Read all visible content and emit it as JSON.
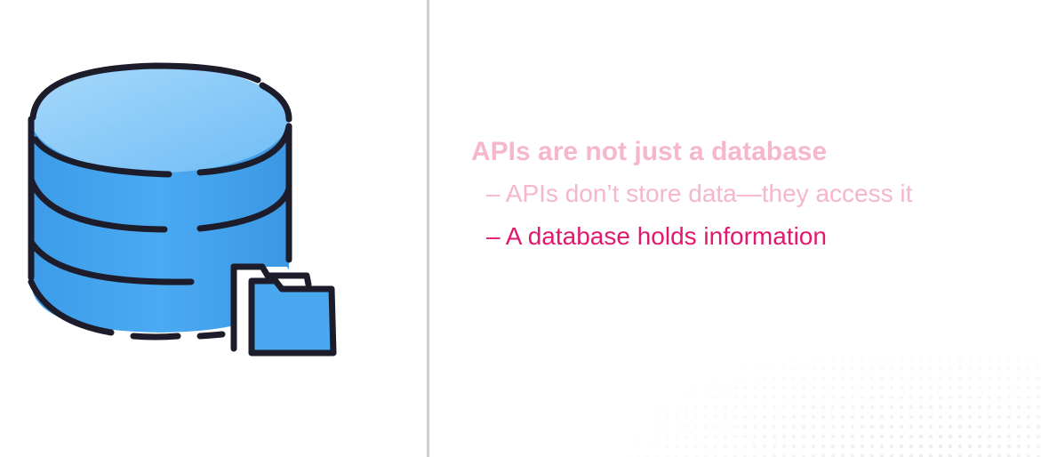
{
  "slide": {
    "heading": "APIs are not just a database",
    "bullets": [
      {
        "text": "– APIs don’t store data—they access it",
        "state": "muted"
      },
      {
        "text": "– A database holds information",
        "state": "active"
      }
    ]
  },
  "illustration": {
    "icon": "database-with-folder-icon"
  },
  "colors": {
    "muted_pink": "#f6b6cb",
    "active_pink": "#e0196e",
    "database_blue": "#4aa8f0",
    "outline": "#1c1c2b"
  }
}
